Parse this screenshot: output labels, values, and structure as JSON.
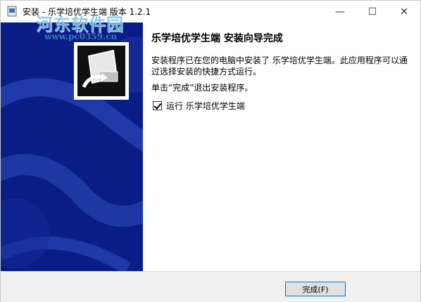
{
  "window": {
    "title": "安装 - 乐学培优学生端 版本 1.2.1",
    "watermark": "河东软件园",
    "watermark_url": "www.pc0359.cn",
    "minimize_glyph": "—",
    "maximize_glyph": "☐",
    "close_glyph": "✕"
  },
  "content": {
    "heading": "乐学培优学生端 安装向导完成",
    "description": "安装程序已在您的电脑中安装了 乐学培优学生端。此应用程序可以通过选择安装的快捷方式运行。",
    "exit_hint": "单击“完成”退出安装程序。",
    "run_checkbox_label": "运行 乐学培优学生端",
    "run_checkbox_checked": true
  },
  "footer": {
    "finish_label": "完成(F)"
  },
  "colors": {
    "sidebar": "#0a1d86",
    "accent": "#0078d7"
  },
  "icons": {
    "app": "installer-icon",
    "sidebar_logo": "computer-install-icon"
  }
}
